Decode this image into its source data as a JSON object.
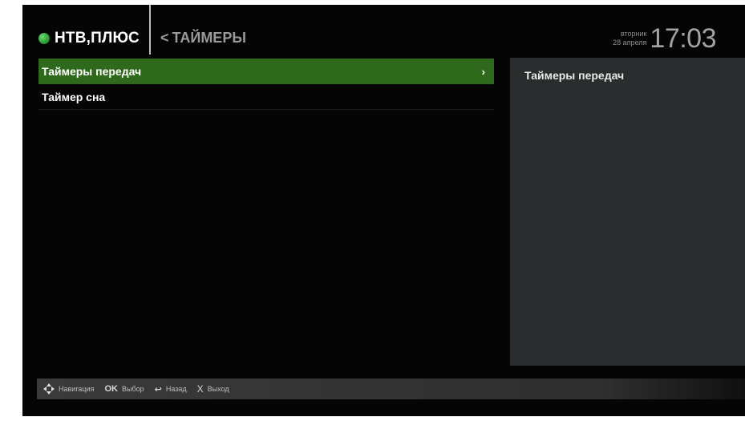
{
  "header": {
    "brand": "НТВ,ПЛЮС",
    "breadcrumb_back": "<",
    "breadcrumb_title": "ТАЙМЕРЫ",
    "weekday": "вторник",
    "date": "28 апреля",
    "time": "17:03"
  },
  "menu": {
    "items": [
      {
        "label": "Таймеры передач",
        "selected": true,
        "chevron": "›"
      },
      {
        "label": "Таймер сна",
        "selected": false
      }
    ]
  },
  "panel": {
    "title": "Таймеры передач"
  },
  "footer": {
    "nav_label": "Навигация",
    "ok_icon": "OK",
    "ok_label": "Выбор",
    "back_icon": "↩",
    "back_label": "Назад",
    "exit_icon": "X",
    "exit_label": "Выход"
  },
  "colors": {
    "accent_green": "#2f6a1c",
    "logo_green": "#2e9a34",
    "panel_bg": "#2a2d2d",
    "screen_bg": "#050505"
  }
}
